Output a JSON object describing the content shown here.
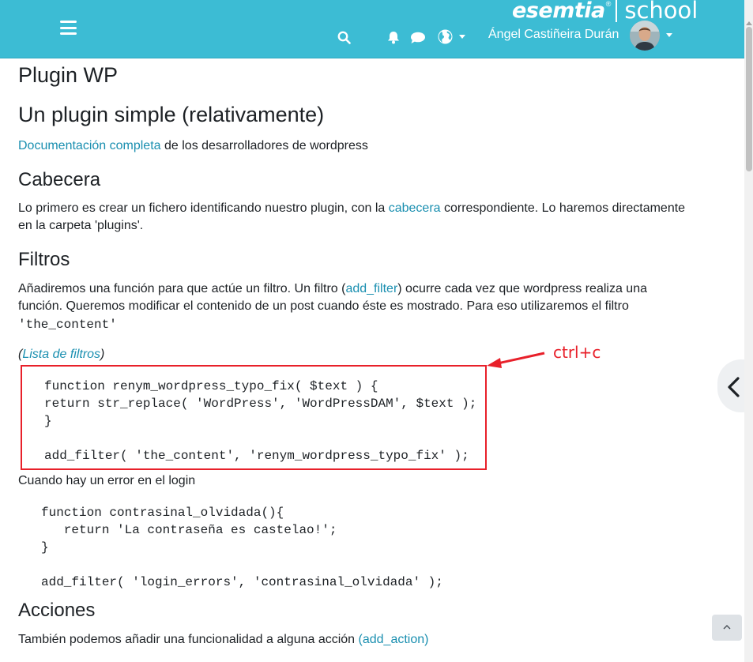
{
  "header": {
    "brand_name": "esemtia",
    "brand_reg": "®",
    "brand_suffix": "school",
    "user_name": "Ángel Castiñeira Durán",
    "icons": [
      "menu-icon",
      "search-icon",
      "bell-icon",
      "comment-icon",
      "globe-icon"
    ],
    "bg_color": "#3cbcd4"
  },
  "page": {
    "title": "Plugin WP",
    "section1": {
      "heading": "Un plugin simple (relativamente)",
      "link": "Documentación completa",
      "text": " de los desarrolladores de wordpress"
    },
    "section2": {
      "heading": "Cabecera",
      "text_before": "Lo primero es crear un fichero identificando nuestro plugin, con la ",
      "link": "cabecera",
      "text_after_line1": " correspondiente. Lo haremos directamente",
      "text_line2": "en la carpeta 'plugins'."
    },
    "section3": {
      "heading": "Filtros",
      "line1_before": "Añadiremos una función para que actúe un filtro. Un filtro (",
      "line1_link": "add_filter",
      "line1_after": ") ocurre cada vez que wordpress realiza una",
      "line2": "función. Queremos modificar el contenido de un post cuando éste es mostrado. Para eso utilizaremos el filtro",
      "code_inline": "'the_content'",
      "list_open": "(",
      "list_link": "Lista de filtros",
      "list_close": ")",
      "code_block1": [
        "function renym_wordpress_typo_fix( $text ) {",
        "return str_replace( 'WordPress', 'WordPressDAM', $text );",
        "}",
        "",
        "add_filter( 'the_content', 'renym_wordpress_typo_fix' );"
      ],
      "annotation": "ctrl+c",
      "annotation_color": "#e8202a",
      "login_text": "Cuando hay un error en el login",
      "code_block2": [
        "function contrasinal_olvidada(){",
        "   return 'La contraseña es castelao!';",
        "}",
        "",
        "add_filter( 'login_errors', 'contrasinal_olvidada' );"
      ]
    },
    "section4": {
      "heading": "Acciones",
      "text": "También podemos añadir una funcionalidad a alguna acción ",
      "link": "(add_action)"
    }
  }
}
